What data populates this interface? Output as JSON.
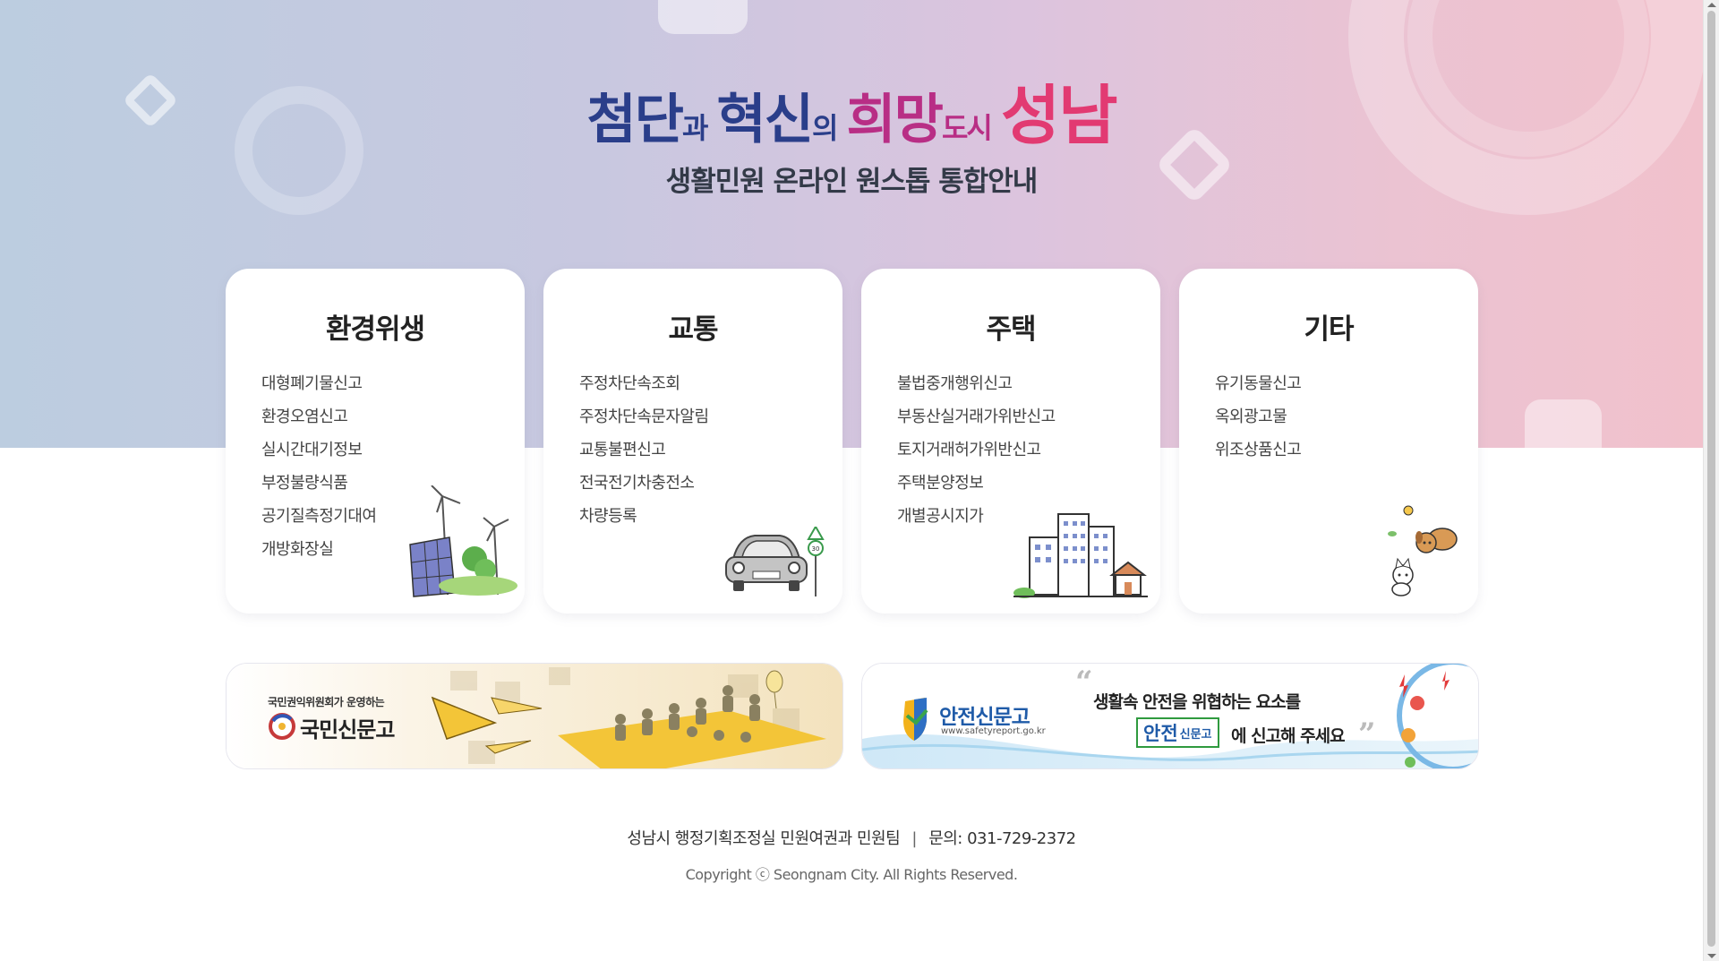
{
  "hero": {
    "title": {
      "part1": "첨단",
      "part1_suffix": "과",
      "part2": "혁신",
      "part2_suffix": "의",
      "part3": "희망",
      "part3_suffix": "도시",
      "part4": "성남"
    },
    "subtitle": "생활민원 온라인 원스톱 통합안내"
  },
  "cards": [
    {
      "title": "환경위생",
      "highlight_color": "#d6e8f7",
      "items": [
        "대형폐기물신고",
        "환경오염신고",
        "실시간대기정보",
        "부정불량식품",
        "공기질측정기대여",
        "개방화장실"
      ]
    },
    {
      "title": "교통",
      "highlight_color": "#fde2cf",
      "items": [
        "주정차단속조회",
        "주정차단속문자알림",
        "교통불편신고",
        "전국전기차충전소",
        "차량등록"
      ]
    },
    {
      "title": "주택",
      "highlight_color": "#dedaf6",
      "items": [
        "불법중개행위신고",
        "부동산실거래가위반신고",
        "토지거래허가위반신고",
        "주택분양정보",
        "개별공시지가"
      ]
    },
    {
      "title": "기타",
      "highlight_color": "#d7f2de",
      "items": [
        "유기동물신고",
        "옥외광고물",
        "위조상품신고"
      ]
    }
  ],
  "banners": {
    "left": {
      "caption": "국민권익위원회가 운영하는",
      "name": "국민신문고"
    },
    "right": {
      "logo_name": "안전신문고",
      "logo_url_text": "www.safetyreport.go.kr",
      "line1": "생활속 안전을 위협하는 요소를",
      "badge_big": "안전",
      "badge_small": "신문고",
      "line2": "에 신고해 주세요"
    }
  },
  "footer": {
    "org": "성남시 행정기획조정실 민원여권과 민원팀",
    "separator": "|",
    "contact": "문의: 031-729-2372",
    "copyright": "Copyright ⓒ Seongnam City. All Rights Reserved."
  }
}
